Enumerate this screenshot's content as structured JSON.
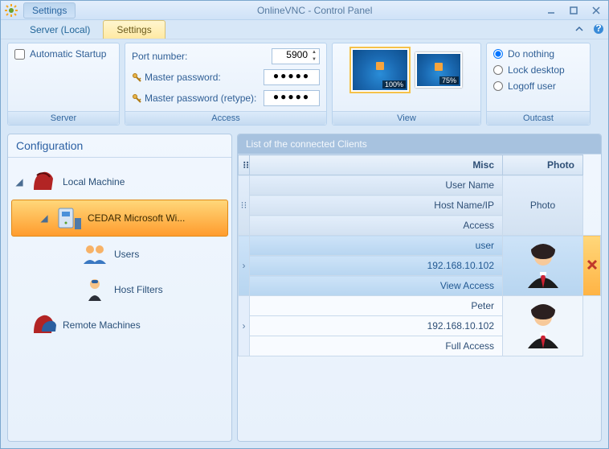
{
  "titlebar": {
    "qat_label": "Settings",
    "title": "OnlineVNC - Control Panel"
  },
  "tabs": {
    "server_local": "Server (Local)",
    "settings": "Settings"
  },
  "ribbon": {
    "server": {
      "group_label": "Server",
      "automatic_startup": "Automatic Startup"
    },
    "access": {
      "group_label": "Access",
      "port_label": "Port number:",
      "port_value": "5900",
      "master_pw_label": "Master password:",
      "master_pw_retype_label": "Master password  (retype):",
      "pw_value": "●●●●●"
    },
    "view": {
      "group_label": "View",
      "thumb1_pct": "100%",
      "thumb2_pct": "75%"
    },
    "outcast": {
      "group_label": "Outcast",
      "do_nothing": "Do nothing",
      "lock_desktop": "Lock desktop",
      "logoff_user": "Logoff user"
    }
  },
  "config": {
    "header": "Configuration",
    "local_machine": "Local Machine",
    "cedar": "CEDAR Microsoft Wi...",
    "users": "Users",
    "host_filters": "Host Filters",
    "remote_machines": "Remote Machines"
  },
  "clients": {
    "header": "List of the connected Clients",
    "col_misc": "Misc",
    "col_photo": "Photo",
    "sub_user": "User Name",
    "sub_host": "Host Name/IP",
    "sub_access": "Access",
    "photo_label": "Photo",
    "rows": [
      {
        "user": "user",
        "host": "192.168.10.102",
        "access": "View Access"
      },
      {
        "user": "Peter",
        "host": "192.168.10.102",
        "access": "Full Access"
      }
    ]
  }
}
